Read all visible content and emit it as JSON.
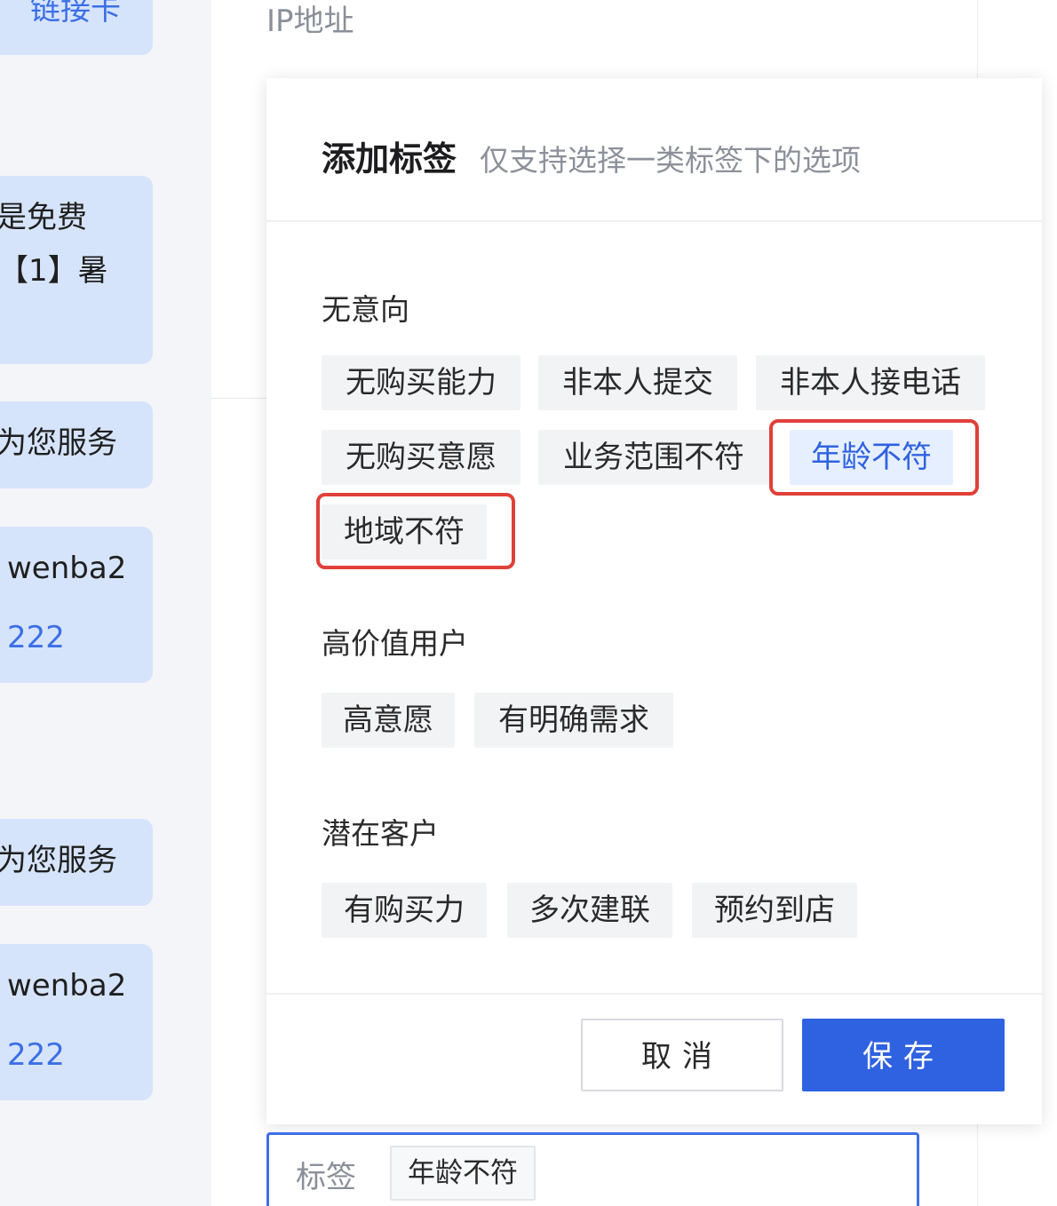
{
  "background": {
    "ip_label": "IP地址",
    "left_messages": [
      {
        "lines": [
          "链接卡"
        ]
      },
      {
        "lines": [
          "是免费",
          "【1】暑"
        ]
      },
      {
        "lines": [
          "为您服务"
        ]
      },
      {
        "lines": [
          "wenba2",
          "222"
        ]
      },
      {
        "lines": [
          "为您服务"
        ]
      },
      {
        "lines": [
          "wenba2",
          "222"
        ]
      }
    ]
  },
  "modal": {
    "title": "添加标签",
    "subtitle": "仅支持选择一类标签下的选项",
    "groups": [
      {
        "title": "无意向",
        "tags": [
          {
            "label": "无购买能力",
            "selected": false
          },
          {
            "label": "非本人提交",
            "selected": false
          },
          {
            "label": "非本人接电话",
            "selected": false
          },
          {
            "label": "无购买意愿",
            "selected": false
          },
          {
            "label": "业务范围不符",
            "selected": false
          },
          {
            "label": "年龄不符",
            "selected": true
          },
          {
            "label": "地域不符",
            "selected": false
          }
        ]
      },
      {
        "title": "高价值用户",
        "tags": [
          {
            "label": "高意愿",
            "selected": false
          },
          {
            "label": "有明确需求",
            "selected": false
          }
        ]
      },
      {
        "title": "潜在客户",
        "tags": [
          {
            "label": "有购买力",
            "selected": false
          },
          {
            "label": "多次建联",
            "selected": false
          },
          {
            "label": "预约到店",
            "selected": false
          }
        ]
      }
    ],
    "cancel_label": "取消",
    "save_label": "保存"
  },
  "tag_field": {
    "label": "标签",
    "value": "年龄不符"
  },
  "colors": {
    "primary": "#2f62e0",
    "highlight_outline": "#e0403a",
    "chip_background": "#f2f3f5",
    "selected_chip_background": "#e6efff",
    "bubble_background": "#d6e4fb"
  }
}
